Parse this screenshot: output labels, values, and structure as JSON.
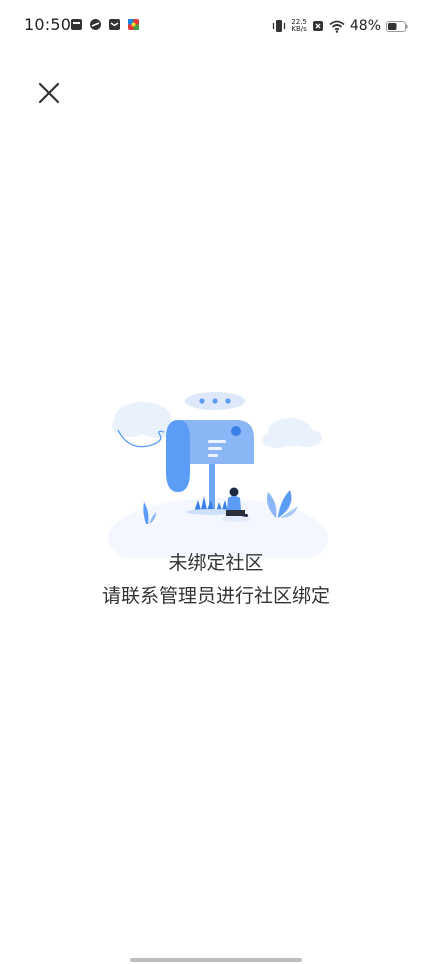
{
  "status_bar": {
    "time": "10:50",
    "net_speed_value": "22.5",
    "net_speed_unit": "KB/s",
    "battery_percent": "48%"
  },
  "empty_state": {
    "title": "未绑定社区",
    "description": "请联系管理员进行社区绑定"
  },
  "colors": {
    "accent_blue": "#5b9cf6",
    "light_blue": "#dbe8fb",
    "text": "#333333"
  },
  "icons": [
    "close-icon",
    "mailbox-illustration",
    "wifi-icon",
    "battery-icon",
    "vibrate-icon"
  ]
}
